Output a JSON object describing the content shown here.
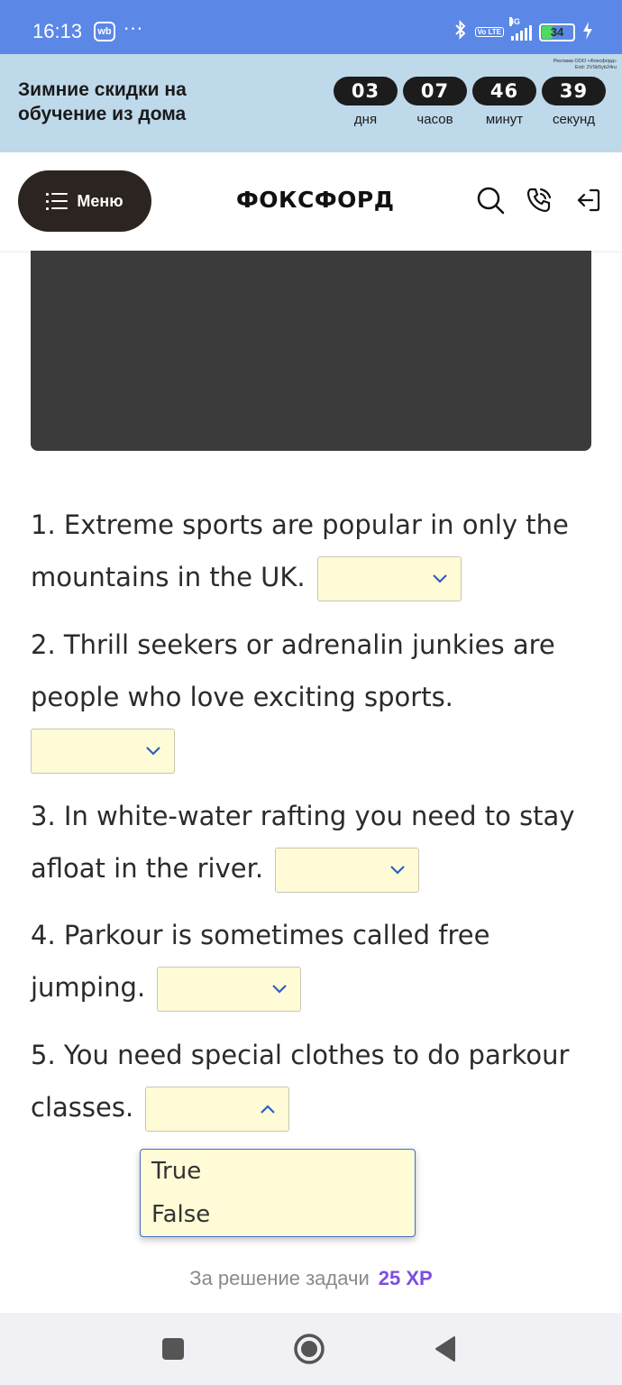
{
  "status_bar": {
    "time": "16:13",
    "app_badge": "wb",
    "more": "···",
    "network": "4G",
    "volte": "Vo LTE",
    "battery": "34"
  },
  "ad_banner": {
    "title": "Зимние скидки на обучение из дома",
    "legal_line1": "Реклама ООО «Фоксфорд»",
    "legal_line2": "Erid: 2VSb5yb24ru",
    "countdown": [
      {
        "value": "03",
        "label": "дня"
      },
      {
        "value": "07",
        "label": "часов"
      },
      {
        "value": "46",
        "label": "минут"
      },
      {
        "value": "39",
        "label": "секунд"
      }
    ]
  },
  "header": {
    "menu_label": "Меню",
    "logo": "ФОКСФОРД"
  },
  "questions": [
    {
      "text": "1. Extreme sports are popular in only the mountains in the UK.",
      "value": ""
    },
    {
      "text": "2. Thrill seekers or adrenalin junkies are people who love exciting sports.",
      "value": ""
    },
    {
      "text": "3. In white-water rafting you need to stay afloat in the river.",
      "value": ""
    },
    {
      "text": "4. Parkour is sometimes called free jumping.",
      "value": ""
    },
    {
      "text": "5. You need special clothes to do parkour classes.",
      "value": ""
    }
  ],
  "dropdown_options": [
    "True",
    "False"
  ],
  "reward": {
    "label": "За решение задачи",
    "value": "25 XP"
  },
  "colors": {
    "status_bar": "#5b87e6",
    "ad_banner": "#bed9ea",
    "select_bg": "#fffbd6",
    "xp_accent": "#7c4ee0"
  }
}
